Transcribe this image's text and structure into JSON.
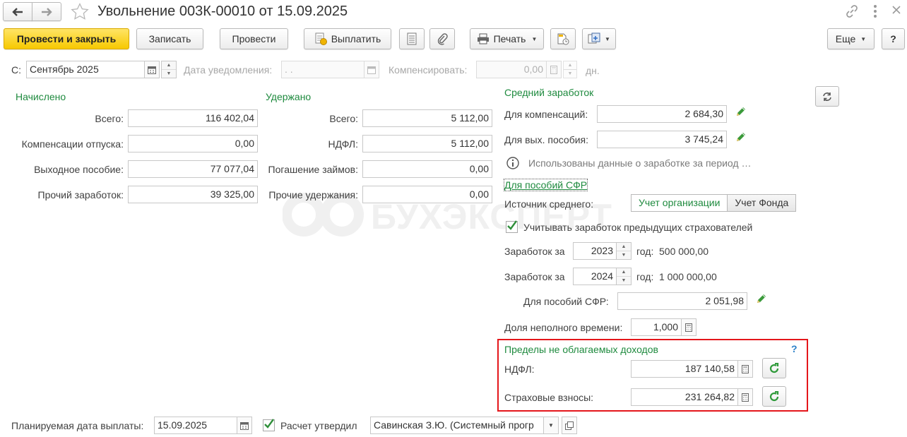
{
  "window": {
    "title": "Увольнение 003К-00010 от 15.09.2025"
  },
  "toolbar": {
    "post_close": "Провести и закрыть",
    "save": "Записать",
    "post": "Провести",
    "pay": "Выплатить",
    "print": "Печать",
    "more": "Еще",
    "help": "?"
  },
  "period": {
    "from_label": "С:",
    "from_value": "Сентябрь 2025",
    "notify_label": "Дата уведомления:",
    "notify_value": " .  .",
    "comp_label": "Компенсировать:",
    "comp_value": "0,00",
    "comp_unit": "дн."
  },
  "accrued": {
    "heading": "Начислено",
    "rows": [
      {
        "label": "Всего:",
        "value": "116 402,04"
      },
      {
        "label": "Компенсации отпуска:",
        "value": "0,00"
      },
      {
        "label": "Выходное пособие:",
        "value": "77 077,04"
      },
      {
        "label": "Прочий заработок:",
        "value": "39 325,00"
      }
    ]
  },
  "withheld": {
    "heading": "Удержано",
    "rows": [
      {
        "label": "Всего:",
        "value": "5 112,00"
      },
      {
        "label": "НДФЛ:",
        "value": "5 112,00"
      },
      {
        "label": "Погашение займов:",
        "value": "0,00"
      },
      {
        "label": "Прочие удержания:",
        "value": "0,00"
      }
    ]
  },
  "average": {
    "heading": "Средний заработок",
    "comp_label": "Для компенсаций:",
    "comp_value": "2 684,30",
    "sev_label": "Для вых. пособия:",
    "sev_value": "3 745,24",
    "info_text": "Использованы данные о заработке за период …",
    "sfr_link": "Для пособий СФР",
    "source_label": "Источник среднего:",
    "source_org": "Учет организации",
    "source_fund": "Учет Фонда",
    "prev_check_label": "Учитывать заработок предыдущих страхователей",
    "earn_label": "Заработок за",
    "year_label": "год:",
    "earn_rows": [
      {
        "year": "2023",
        "amount": "500 000,00"
      },
      {
        "year": "2024",
        "amount": "1 000 000,00"
      }
    ],
    "sfr_label": "Для пособий СФР:",
    "sfr_value": "2 051,98",
    "parttime_label": "Доля неполного времени:",
    "parttime_value": "1,000"
  },
  "limits": {
    "heading": "Пределы не облагаемых доходов",
    "help": "?",
    "ndfl_label": "НДФЛ:",
    "ndfl_value": "187 140,58",
    "ins_label": "Страховые взносы:",
    "ins_value": "231 264,82"
  },
  "footer": {
    "pay_date_label": "Планируемая дата выплаты:",
    "pay_date_value": "15.09.2025",
    "approved_label": "Расчет утвердил",
    "approved_value": "Савинская З.Ю. (Системный прогр"
  },
  "watermark": {
    "text": "БУХЭКСПЕРТ"
  },
  "colors": {
    "accent_green": "#1e8a3e",
    "primary_yellow": "#f7c900",
    "highlight_red": "#e4161b"
  }
}
